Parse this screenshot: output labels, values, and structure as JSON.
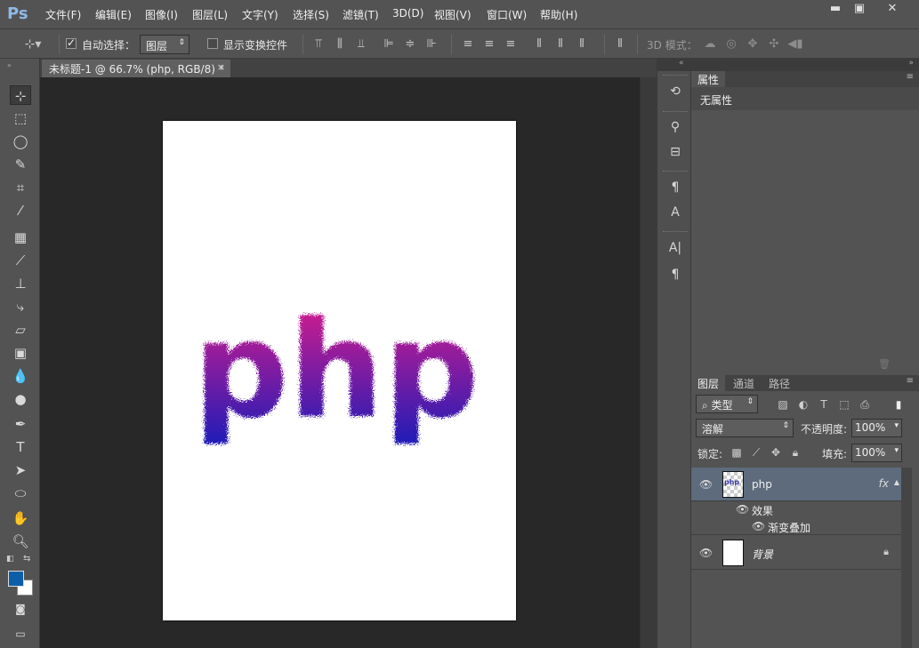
{
  "app": {
    "logo": "Ps",
    "menu": [
      "文件(F)",
      "编辑(E)",
      "图像(I)",
      "图层(L)",
      "文字(Y)",
      "选择(S)",
      "滤镜(T)",
      "3D(D)",
      "视图(V)",
      "窗口(W)",
      "帮助(H)"
    ],
    "window_buttons": {
      "minimize": "▬",
      "restore": "▣",
      "close": "✕"
    }
  },
  "options": {
    "auto_select_label": "自动选择：",
    "auto_select_checked": true,
    "auto_select_target": "图层",
    "show_transform_label": "显示变换控件",
    "show_transform_checked": false,
    "mode_3d_label": "3D 模式："
  },
  "document": {
    "tab_title": "未标题-1 @ 66.7% (php, RGB/8) *",
    "close_glyph": "×",
    "artwork_text": "php",
    "canvas_bg": "#282828",
    "gradient_colors": [
      "#e0208a",
      "#1a1ab8"
    ]
  },
  "tools": {
    "foreground_color": "#0d5ea8",
    "background_color": "#ffffff",
    "items": [
      "move-tool",
      "marquee-tool",
      "lasso-tool",
      "quick-select-tool",
      "crop-tool",
      "eyedropper-tool",
      "healing-tool",
      "brush-tool",
      "clone-stamp-tool",
      "history-brush-tool",
      "eraser-tool",
      "gradient-tool",
      "blur-tool",
      "dodge-tool",
      "pen-tool",
      "type-tool",
      "path-select-tool",
      "shape-tool",
      "hand-tool",
      "zoom-tool"
    ]
  },
  "properties": {
    "tab": "属性",
    "empty_text": "无属性"
  },
  "layers": {
    "tabs": [
      "图层",
      "通道",
      "路径"
    ],
    "filter_kind": "类型",
    "blend_mode": "溶解",
    "opacity_label": "不透明度:",
    "opacity_value": "100%",
    "lock_label": "锁定:",
    "fill_label": "填充:",
    "fill_value": "100%",
    "items": [
      {
        "name": "php",
        "selected": true,
        "fx": "fx",
        "thumb_text": "php"
      },
      {
        "name": "背景",
        "selected": false,
        "locked": true
      }
    ],
    "effects_label": "效果",
    "effect_name": "渐变叠加"
  }
}
